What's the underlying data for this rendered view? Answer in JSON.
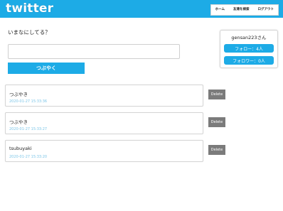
{
  "header": {
    "logo": "twitter",
    "nav": [
      "ホーム",
      "友達を検索",
      "ログアウト"
    ]
  },
  "compose": {
    "prompt": "いまなにしてる？",
    "input_value": "",
    "submit_label": "つぶやく"
  },
  "profile": {
    "username": "gensan223さん",
    "follow": "フォロー：4人",
    "follower": "フォロワー：0人"
  },
  "tweets": [
    {
      "text": "つぶやき",
      "time": "2020-01-27 15:33:36",
      "delete_label": "Delete"
    },
    {
      "text": "つぶやき",
      "time": "2020-01-27 15:33:27",
      "delete_label": "Delete"
    },
    {
      "text": "tsubuyaki",
      "time": "2020-01-27 15:33:20",
      "delete_label": "Delete"
    }
  ],
  "colors": {
    "brand": "#1dabe6",
    "delete": "#7b7b7b",
    "timestamp": "#7cc6e8"
  }
}
